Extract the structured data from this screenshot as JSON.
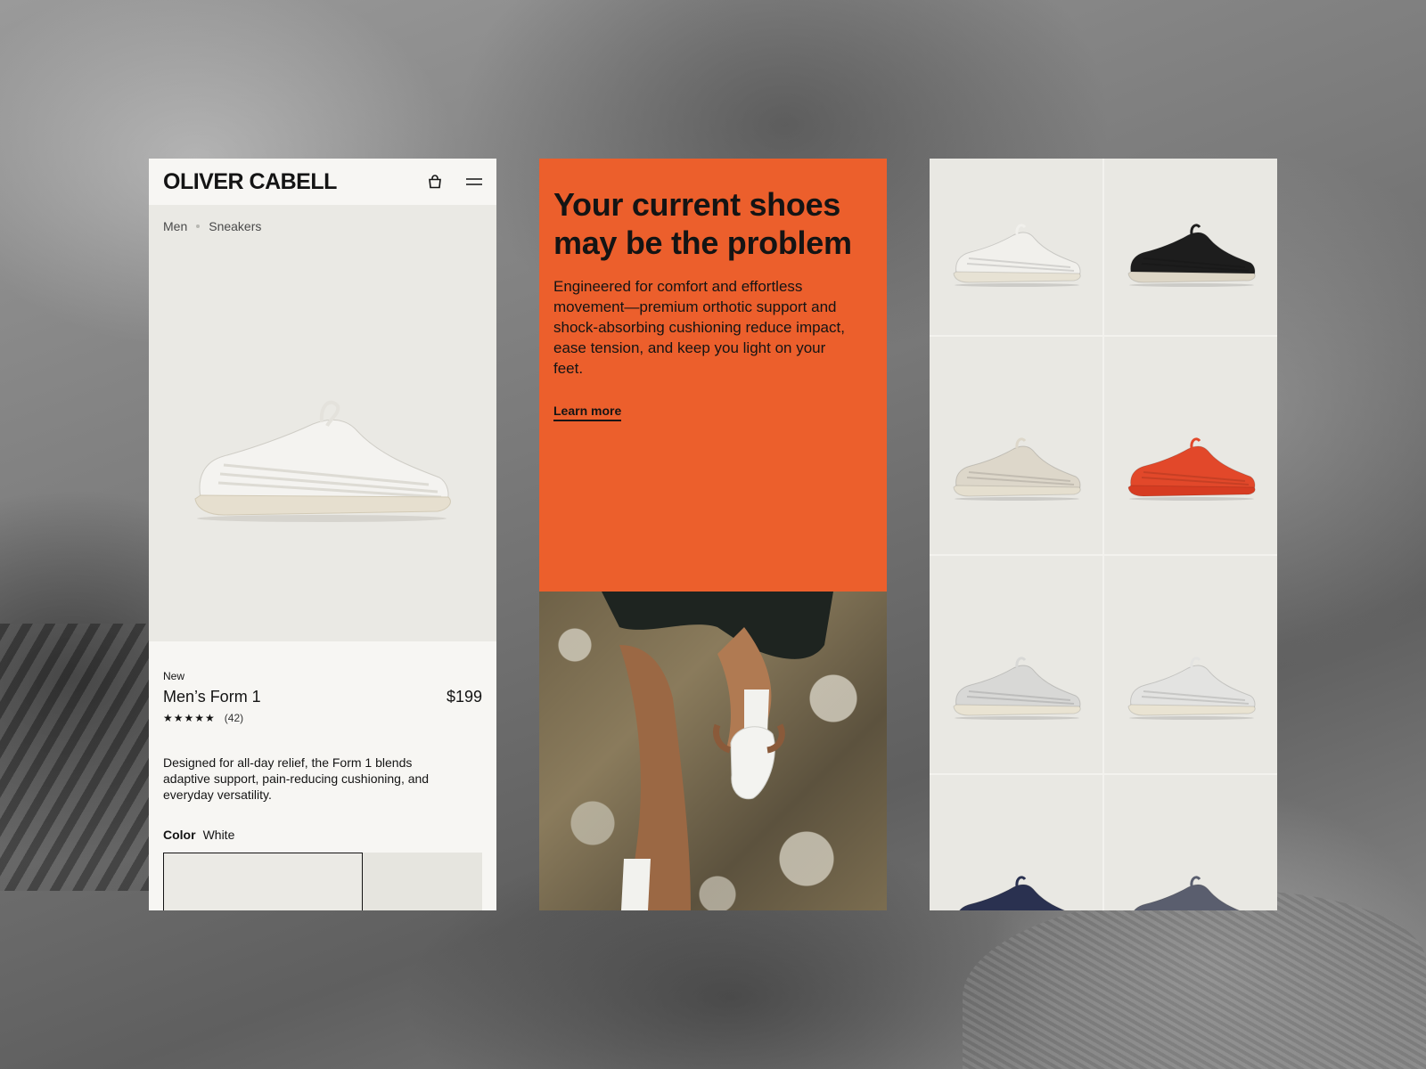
{
  "brand": {
    "logo": "OLIVER CABELL"
  },
  "header": {
    "bag_icon": "bag-icon",
    "menu_icon": "menu-icon"
  },
  "breadcrumb": {
    "items": [
      "Men",
      "Sneakers"
    ]
  },
  "product": {
    "badge": "New",
    "name": "Men’s Form 1",
    "price": "$199",
    "stars": "★★★★★",
    "rating_value": 5,
    "review_count": "(42)",
    "description": "Designed for all-day relief, the Form 1 blends adaptive support, pain-reducing cushioning, and everyday versatility.",
    "color_label": "Color",
    "color_value": "White"
  },
  "promo": {
    "title": "Your current shoes may be the problem",
    "body": "Engineered for comfort and effortless movement—premium orthotic support and shock-absorbing cushioning reduce impact, ease tension, and keep you light on your feet.",
    "cta": "Learn more",
    "accent_color": "#ec5f2c"
  },
  "grid": {
    "items": [
      {
        "colorway": "white",
        "upper": "#f1f0ec",
        "sole": "#e7e2d4"
      },
      {
        "colorway": "black",
        "upper": "#1d1d1d",
        "sole": "#ddd6c6"
      },
      {
        "colorway": "sand",
        "upper": "#ddd7ca",
        "sole": "#e5dfcf"
      },
      {
        "colorway": "orange",
        "upper": "#e2482a",
        "sole": "#d63c22"
      },
      {
        "colorway": "grey-white",
        "upper": "#d8d8d6",
        "sole": "#e9e3d2"
      },
      {
        "colorway": "white-blue",
        "upper": "#e3e3e1",
        "sole": "#e9e3d2"
      },
      {
        "colorway": "navy",
        "upper": "#2a3150",
        "sole": "#e5dfcf"
      },
      {
        "colorway": "navy-grey",
        "upper": "#5a5e6e",
        "sole": "#e5dfcf"
      }
    ]
  }
}
